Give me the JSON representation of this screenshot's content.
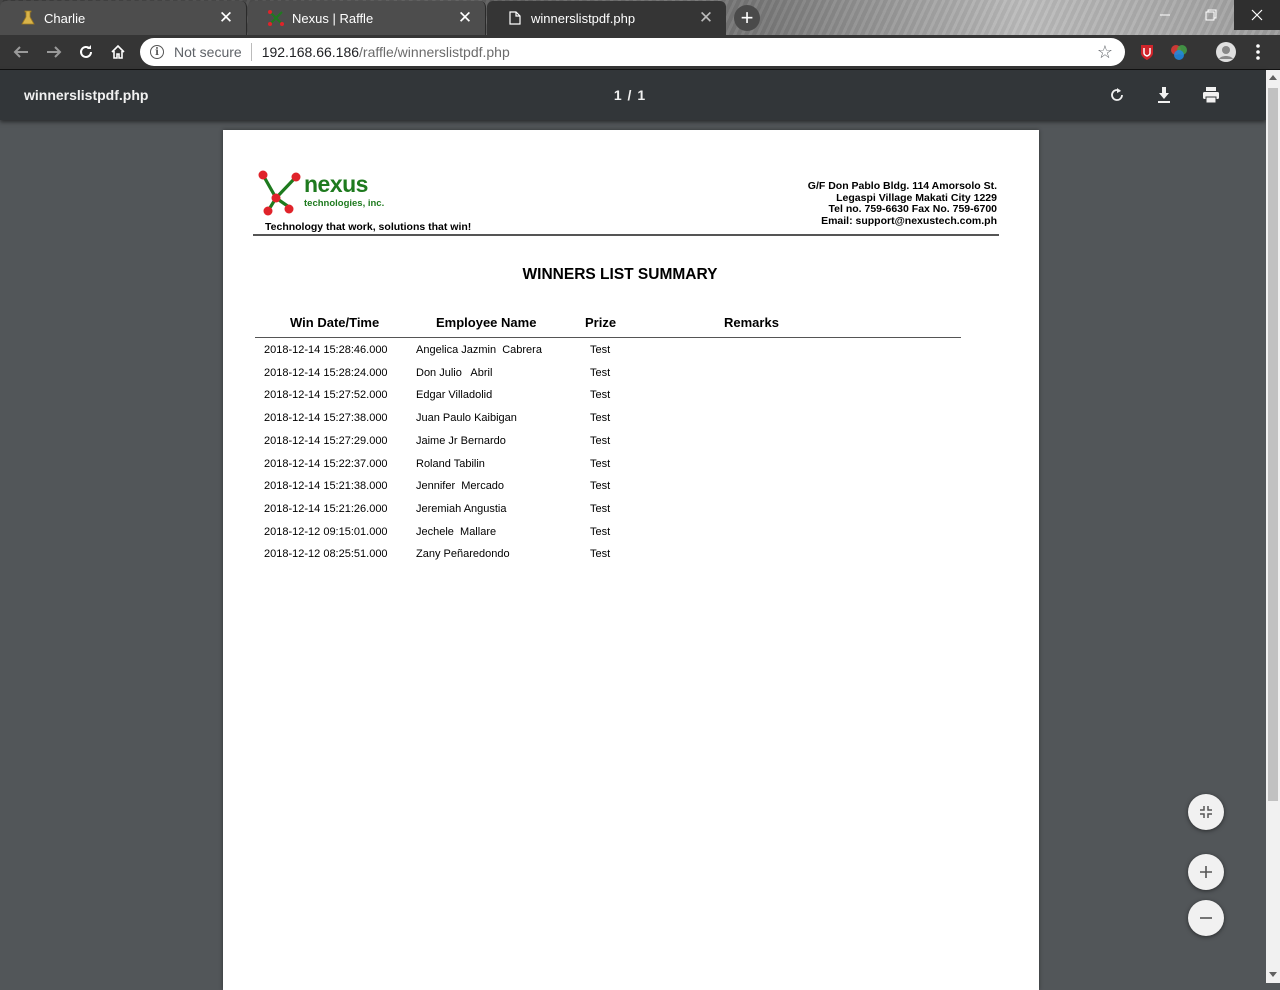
{
  "tabs": [
    {
      "title": "Charlie",
      "close": "✕"
    },
    {
      "title": "Nexus | Raffle",
      "close": "✕"
    },
    {
      "title": "winnerslistpdf.php",
      "close": "✕"
    }
  ],
  "new_tab": "+",
  "omnibox": {
    "security": "Not secure",
    "host": "192.168.66.186",
    "path": "/raffle/winnerslistpdf.php"
  },
  "pdf_viewer": {
    "title": "winnerslistpdf.php",
    "page_indicator": "1 / 1"
  },
  "document": {
    "brand_word": "nexus",
    "brand_sub": "technologies, inc.",
    "tagline": "Technology that work, solutions that win!",
    "address": [
      "G/F Don Pablo Bldg. 114 Amorsolo St.",
      "Legaspi Village Makati City 1229",
      "Tel no. 759-6630 Fax No. 759-6700",
      "Email: support@nexustech.com.ph"
    ],
    "title": "WINNERS LIST SUMMARY",
    "columns": [
      "Win Date/Time",
      "Employee Name",
      "Prize",
      "Remarks"
    ],
    "rows": [
      {
        "datetime": "2018-12-14 15:28:46.000",
        "name": "Angelica Jazmin  Cabrera",
        "prize": "Test",
        "remarks": ""
      },
      {
        "datetime": "2018-12-14 15:28:24.000",
        "name": "Don Julio   Abril",
        "prize": "Test",
        "remarks": ""
      },
      {
        "datetime": "2018-12-14 15:27:52.000",
        "name": "Edgar Villadolid",
        "prize": "Test",
        "remarks": ""
      },
      {
        "datetime": "2018-12-14 15:27:38.000",
        "name": "Juan Paulo Kaibigan",
        "prize": "Test",
        "remarks": ""
      },
      {
        "datetime": "2018-12-14 15:27:29.000",
        "name": "Jaime Jr Bernardo",
        "prize": "Test",
        "remarks": ""
      },
      {
        "datetime": "2018-12-14 15:22:37.000",
        "name": "Roland Tabilin",
        "prize": "Test",
        "remarks": ""
      },
      {
        "datetime": "2018-12-14 15:21:38.000",
        "name": "Jennifer  Mercado",
        "prize": "Test",
        "remarks": ""
      },
      {
        "datetime": "2018-12-14 15:21:26.000",
        "name": "Jeremiah Angustia",
        "prize": "Test",
        "remarks": ""
      },
      {
        "datetime": "2018-12-12 09:15:01.000",
        "name": "Jechele  Mallare",
        "prize": "Test",
        "remarks": ""
      },
      {
        "datetime": "2018-12-12 08:25:51.000",
        "name": "Zany Peñaredondo",
        "prize": "Test",
        "remarks": ""
      }
    ]
  },
  "colors": {
    "viewer_bg": "#525659",
    "viewer_header": "#323639",
    "brand_green": "#1e7a1e",
    "brand_red": "#e0232a"
  },
  "icons": {
    "tab_0": "beaker-icon",
    "tab_1": "nexus-logo-icon",
    "tab_2": "document-icon",
    "toolbar": [
      "back-icon",
      "forward-icon",
      "reload-icon",
      "home-icon",
      "info-icon",
      "star-icon"
    ],
    "pdf": [
      "rotate-icon",
      "download-icon",
      "print-icon",
      "fit-page-icon",
      "zoom-in-icon",
      "zoom-out-icon"
    ]
  }
}
